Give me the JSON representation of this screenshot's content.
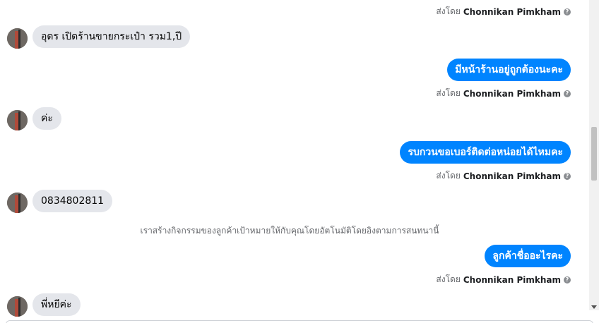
{
  "messages": {
    "sent_by_prefix": "ส่งโดย",
    "sender_name": "Chonnikan Pimkham",
    "help_glyph": "?",
    "in_1": "อุดร เปิดร้านขายกระเป๋า รวม1,ปี",
    "out_1": "มีหน้าร้านอยู่ถูกต้องนะคะ",
    "in_2": "ค่ะ",
    "out_2": "รบกวนขอเบอร์ติดต่อหน่อยได้ไหมคะ",
    "in_3": "0834802811",
    "system_note": "เราสร้างกิจกรรมของลูกค้าเป้าหมายให้กับคุณโดยอัตโนมัติโดยอิงตามการสนทนานี้",
    "out_3": "ลูกค้าชื่ออะไรคะ",
    "in_4": "พี่หยีค่ะ"
  },
  "colors": {
    "outgoing_bubble": "#0084ff",
    "incoming_bubble": "#e4e6eb",
    "meta_text": "#65676b"
  },
  "icons": {
    "help": "help-icon",
    "avatar": "avatar"
  }
}
